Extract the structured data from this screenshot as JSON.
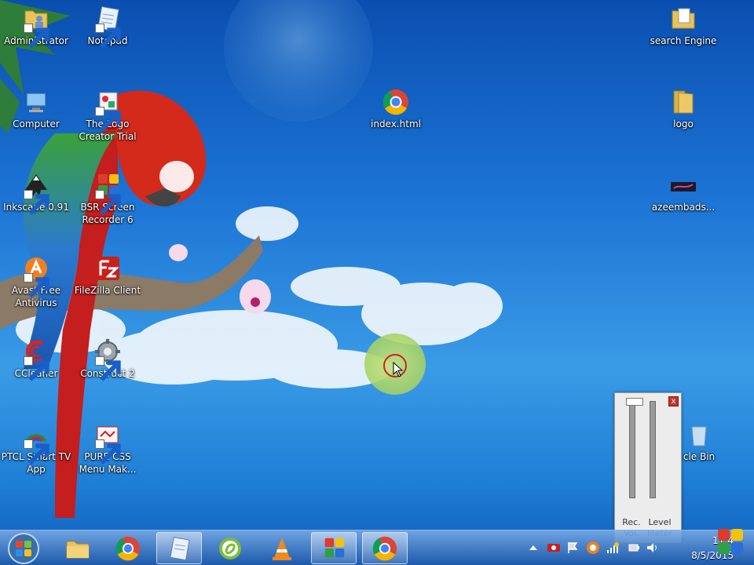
{
  "desktop": {
    "icons": [
      {
        "label": "Administrator",
        "icon": "folder-user-icon"
      },
      {
        "label": "Notepad",
        "icon": "notepad-icon"
      },
      {
        "label": "search Engine",
        "icon": "folder-icon"
      },
      {
        "label": "Computer",
        "icon": "computer-icon"
      },
      {
        "label": "The Logo Creator Trial",
        "icon": "logo-creator-icon"
      },
      {
        "label": "index.html",
        "icon": "chrome-icon"
      },
      {
        "label": "logo",
        "icon": "folder-icon"
      },
      {
        "label": "Inkscape 0.91",
        "icon": "inkscape-icon"
      },
      {
        "label": "BSR Screen Recorder 6",
        "icon": "bsr-recorder-icon"
      },
      {
        "label": "azeembads...",
        "icon": "image-file-icon"
      },
      {
        "label": "Avast Free Antivirus",
        "icon": "avast-icon"
      },
      {
        "label": "FileZilla Client",
        "icon": "filezilla-icon"
      },
      {
        "label": "CCleaner",
        "icon": "ccleaner-icon"
      },
      {
        "label": "Construct 2",
        "icon": "construct-icon"
      },
      {
        "label": "PTCL Smart TV App",
        "icon": "ptcl-tv-icon"
      },
      {
        "label": "PURE CSS Menu Mak...",
        "icon": "pure-css-icon"
      },
      {
        "label": "cle Bin",
        "icon": "recycle-bin-icon"
      }
    ]
  },
  "taskbar": {
    "start_label": "Start",
    "pinned": [
      {
        "name": "explorer",
        "icon": "folder-icon"
      },
      {
        "name": "chrome",
        "icon": "chrome-icon"
      },
      {
        "name": "notepad",
        "icon": "notepad-icon"
      },
      {
        "name": "dreamweaver",
        "icon": "dreamweaver-icon"
      },
      {
        "name": "vlc",
        "icon": "vlc-icon"
      },
      {
        "name": "bsr",
        "icon": "bsr-recorder-icon"
      },
      {
        "name": "chrome-active",
        "icon": "chrome-icon"
      }
    ],
    "clock": {
      "time": "11:4",
      "date": "8/5/2015"
    }
  },
  "level_meter": {
    "close_label": "x",
    "rec_vol_label": "Rec. Vol.",
    "level_meter_label": "Level Meter",
    "rec_vol_level": 1.0
  },
  "colors": {
    "sky_top": "#0a4fb0",
    "sky_mid": "#3a9be6",
    "taskbar": "#2a6ac0",
    "chrome_red": "#db4437",
    "chrome_green": "#0f9d58",
    "chrome_yellow": "#f4b400",
    "chrome_blue": "#4285f4"
  }
}
